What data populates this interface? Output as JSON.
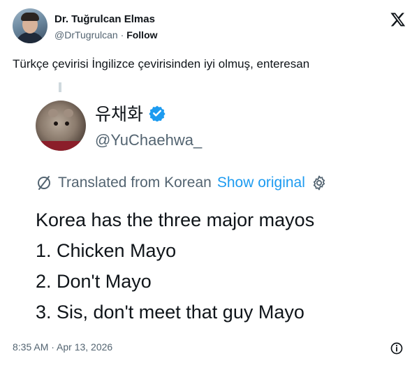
{
  "author": {
    "name": "Dr. Tuğrulcan Elmas",
    "handle": "@DrTugrulcan",
    "separator": "·",
    "follow_label": "Follow"
  },
  "tweet": {
    "text": "Türkçe çevirisi İngilizce çevirisinden iyi olmuş, enteresan",
    "timestamp": "8:35 AM · Apr 13, 2026"
  },
  "quoted": {
    "name": "유채화",
    "handle": "@YuChaehwa_",
    "translated_label": "Translated from Korean",
    "show_original_label": "Show original",
    "lines": [
      "Korea has the three major mayos",
      "1. Chicken Mayo",
      "2. Don't Mayo",
      "3. Sis, don't meet that guy Mayo"
    ]
  },
  "colors": {
    "link": "#1d9bf0",
    "muted": "#536471",
    "text": "#0f1419"
  },
  "icons": [
    "x-logo-icon",
    "verified-badge-icon",
    "translate-icon",
    "gear-icon",
    "info-icon"
  ]
}
